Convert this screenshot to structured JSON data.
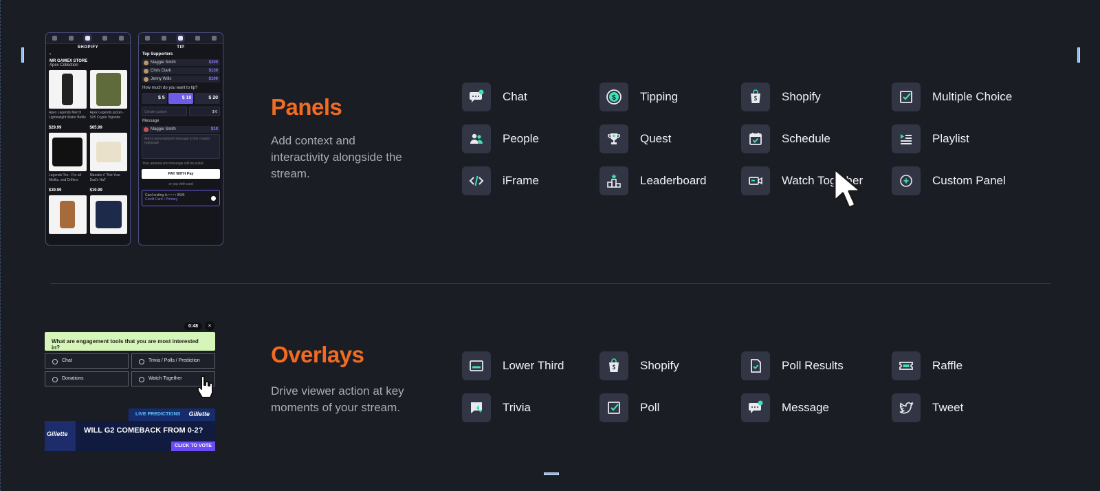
{
  "panels": {
    "title": "Panels",
    "description": "Add context and interactivity alongside the stream.",
    "items": [
      {
        "label": "Chat",
        "icon": "chat-icon"
      },
      {
        "label": "Tipping",
        "icon": "dollar-icon"
      },
      {
        "label": "Shopify",
        "icon": "shopify-bag-icon"
      },
      {
        "label": "Multiple Choice",
        "icon": "checkbox-icon"
      },
      {
        "label": "People",
        "icon": "people-icon"
      },
      {
        "label": "Quest",
        "icon": "trophy-icon"
      },
      {
        "label": "Schedule",
        "icon": "calendar-check-icon"
      },
      {
        "label": "Playlist",
        "icon": "playlist-icon"
      },
      {
        "label": "iFrame",
        "icon": "code-icon"
      },
      {
        "label": "Leaderboard",
        "icon": "podium-icon"
      },
      {
        "label": "Watch Together",
        "icon": "video-camera-icon"
      },
      {
        "label": "Custom Panel",
        "icon": "plus-circle-icon"
      }
    ]
  },
  "overlays": {
    "title": "Overlays",
    "description": "Drive viewer action at key moments of your stream.",
    "items": [
      {
        "label": "Lower Third",
        "icon": "lower-third-icon"
      },
      {
        "label": "Shopify",
        "icon": "shopify-bag-icon"
      },
      {
        "label": "Poll Results",
        "icon": "poll-results-icon"
      },
      {
        "label": "Raffle",
        "icon": "ticket-icon"
      },
      {
        "label": "Trivia",
        "icon": "trivia-icon"
      },
      {
        "label": "Poll",
        "icon": "checkbox-icon"
      },
      {
        "label": "Message",
        "icon": "message-icon"
      },
      {
        "label": "Tweet",
        "icon": "twitter-icon"
      }
    ]
  },
  "shop_preview": {
    "title": "SHOPIFY",
    "store": "MR GAMEX STORE",
    "collection": "Apex Collection",
    "products": [
      {
        "name": "Apex Legends Merch Lightweight Water Bottle",
        "price": "$29.99"
      },
      {
        "name": "Apex Legends jacket - S05 Crypto Vignette",
        "price": "$65.99"
      },
      {
        "name": "Legends Tee - For all Misfits, and Drifters",
        "price": "$39.99"
      },
      {
        "name": "Maestro // \"Not Your Dad's Hat\"",
        "price": "$19.99"
      }
    ]
  },
  "tip_preview": {
    "title": "TIP",
    "top_supporters": "Top Supporters",
    "supporters": [
      {
        "name": "Maggie Smith",
        "amount": "$200"
      },
      {
        "name": "Chris Clark",
        "amount": "$130"
      },
      {
        "name": "Jenny Wills",
        "amount": "$100"
      }
    ],
    "question": "How much do you want to tip?",
    "amounts": [
      "$ 5",
      "$ 10",
      "$ 20"
    ],
    "custom_placeholder": "Create custom",
    "custom_value": "$ 0",
    "message_label": "Message",
    "message_name": "Maggie Smith",
    "message_amount": "$10",
    "message_placeholder": "Add a personalized message to the creator (optional)",
    "public_note": "Your amount and message will be public",
    "pay_button": "PAY WITH  Pay",
    "or_pay": "or pay with card",
    "card_line": "Card ending in • • • •  9596",
    "card_sub": "Credit Card • Primary"
  },
  "poll_preview": {
    "timer": "0:48",
    "close": "×",
    "question": "What are engagement tools that you are most interested in?",
    "options": [
      "Chat",
      "Trivia / Polls / Prediction",
      "Donations",
      "Watch Together"
    ]
  },
  "prediction_preview": {
    "live_label": "LIVE PREDICTIONS",
    "brand": "Gillette",
    "question": "WILL G2 COMEBACK FROM 0-2?",
    "cta": "CLICK TO VOTE"
  },
  "colors": {
    "background": "#1b1d25",
    "accent_orange": "#f26b21",
    "icon_tile": "#323543",
    "icon_green": "#3ee0b4"
  }
}
